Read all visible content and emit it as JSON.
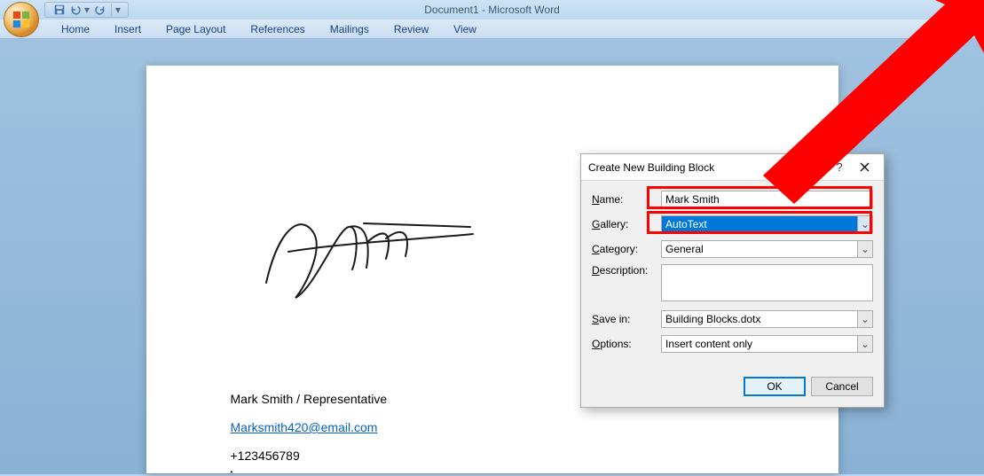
{
  "window": {
    "title": "Document1 - Microsoft Word"
  },
  "ribbon": {
    "tabs": [
      "Home",
      "Insert",
      "Page Layout",
      "References",
      "Mailings",
      "Review",
      "View"
    ]
  },
  "document": {
    "name_line": "Mark Smith / Representative",
    "email": "Marksmith420@email.com",
    "phone": "+123456789"
  },
  "dialog": {
    "title": "Create New Building Block",
    "labels": {
      "name": "Name:",
      "gallery": "Gallery:",
      "category": "Category:",
      "description": "Description:",
      "save_in": "Save in:",
      "options": "Options:"
    },
    "values": {
      "name": "Mark Smith",
      "gallery": "AutoText",
      "category": "General",
      "description": "",
      "save_in": "Building Blocks.dotx",
      "options": "Insert content only"
    },
    "buttons": {
      "ok": "OK",
      "cancel": "Cancel"
    }
  }
}
